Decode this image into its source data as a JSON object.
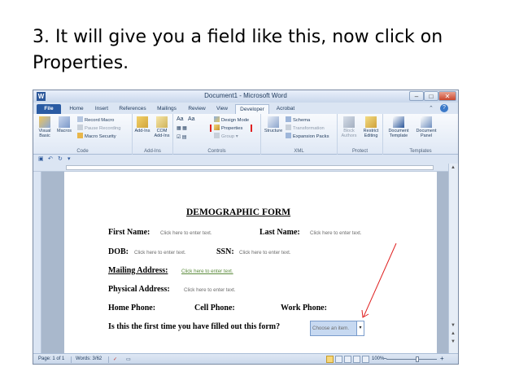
{
  "slide": {
    "title": "3. It will give you a field like this, now click on Properties."
  },
  "window": {
    "title": "Document1 - Microsoft Word",
    "app_icon_letter": "W",
    "controls": {
      "minimize": "–",
      "maximize": "□",
      "close": "✕"
    }
  },
  "tabs": [
    "File",
    "Home",
    "Insert",
    "References",
    "Mailings",
    "Review",
    "View",
    "Developer",
    "Acrobat"
  ],
  "active_tab": "Developer",
  "ribbon": {
    "code": {
      "label": "Code",
      "visual_basic": "Visual Basic",
      "macros": "Macros",
      "record_macro": "Record Macro",
      "pause_recording": "Pause Recording",
      "macro_security": "Macro Security"
    },
    "addins": {
      "label": "Add-Ins",
      "addins": "Add-Ins",
      "com_addins": "COM Add-Ins"
    },
    "controls": {
      "label": "Controls",
      "aa1": "Aa",
      "aa2": "Aa",
      "design_mode": "Design Mode",
      "properties": "Properties",
      "group": "Group"
    },
    "xml": {
      "label": "XML",
      "structure": "Structure",
      "schema": "Schema",
      "transformation": "Transformation",
      "expansion_packs": "Expansion Packs"
    },
    "protect": {
      "label": "Protect",
      "block_authors": "Block Authors",
      "restrict_editing": "Restrict Editing"
    },
    "templates": {
      "label": "Templates",
      "document_template": "Document Template",
      "document_panel": "Document Panel"
    }
  },
  "document": {
    "title": "DEMOGRAPHIC FORM",
    "placeholder": "Click here to enter text.",
    "labels": {
      "first_name": "First Name:",
      "last_name": "Last Name:",
      "dob": "DOB:",
      "ssn": "SSN:",
      "mailing_address": "Mailing Address:",
      "physical_address": "Physical Address:",
      "home_phone": "Home Phone:",
      "cell_phone": "Cell Phone:",
      "work_phone": "Work Phone:",
      "first_time": "Is this the first time you have filled out this form?"
    },
    "dropdown_placeholder": "Choose an item."
  },
  "status": {
    "page": "Page: 1 of 1",
    "words": "Words: 3/62",
    "zoom": "100%"
  },
  "colors": {
    "annotation_arrow": "#e02020",
    "file_tab": "#2a5ba3",
    "dropdown_fill": "#c7d9f1"
  }
}
